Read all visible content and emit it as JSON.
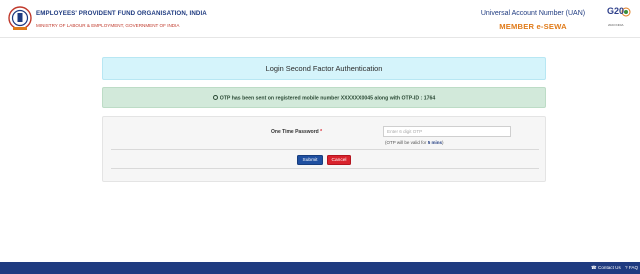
{
  "header": {
    "org_name": "EMPLOYEES' PROVIDENT FUND ORGANISATION, INDIA",
    "ministry": "MINISTRY OF LABOUR & EMPLOYMENT, GOVERNMENT OF INDIA",
    "uan_title": "Universal Account Number (UAN)",
    "sewa_title": "MEMBER e-SEWA",
    "g20_logo_text": "G20",
    "g20_logo_subtext": "2023 INDIA"
  },
  "auth": {
    "title": "Login Second Factor Authentication"
  },
  "alert": {
    "message": "OTP has been sent on registered mobile number XXXXXX0045 along with OTP-ID : 1764"
  },
  "form": {
    "otp_label": "One Time Password",
    "required_mark": "*",
    "otp_placeholder": "Enter 6 digit OTP",
    "otp_value": "",
    "hint_prefix": "(OTP will be valid for ",
    "hint_time": "5 mins",
    "hint_suffix": ")",
    "submit_label": "Submit",
    "cancel_label": "Cancel"
  },
  "footer": {
    "contact_label": "Contact Us",
    "faq_label": "FAQ"
  },
  "colors": {
    "brand_blue": "#1f3b80",
    "accent_orange": "#e07b1a",
    "auth_banner_bg": "#d5f4fb",
    "alert_bg": "#d2e9da",
    "submit_blue": "#1f4fa0",
    "cancel_red": "#d9232d"
  },
  "icons": {
    "logo": "epfo-emblem-icon",
    "g20": "g20-logo-icon",
    "alert": "info-circle-icon",
    "contact": "phone-icon"
  }
}
